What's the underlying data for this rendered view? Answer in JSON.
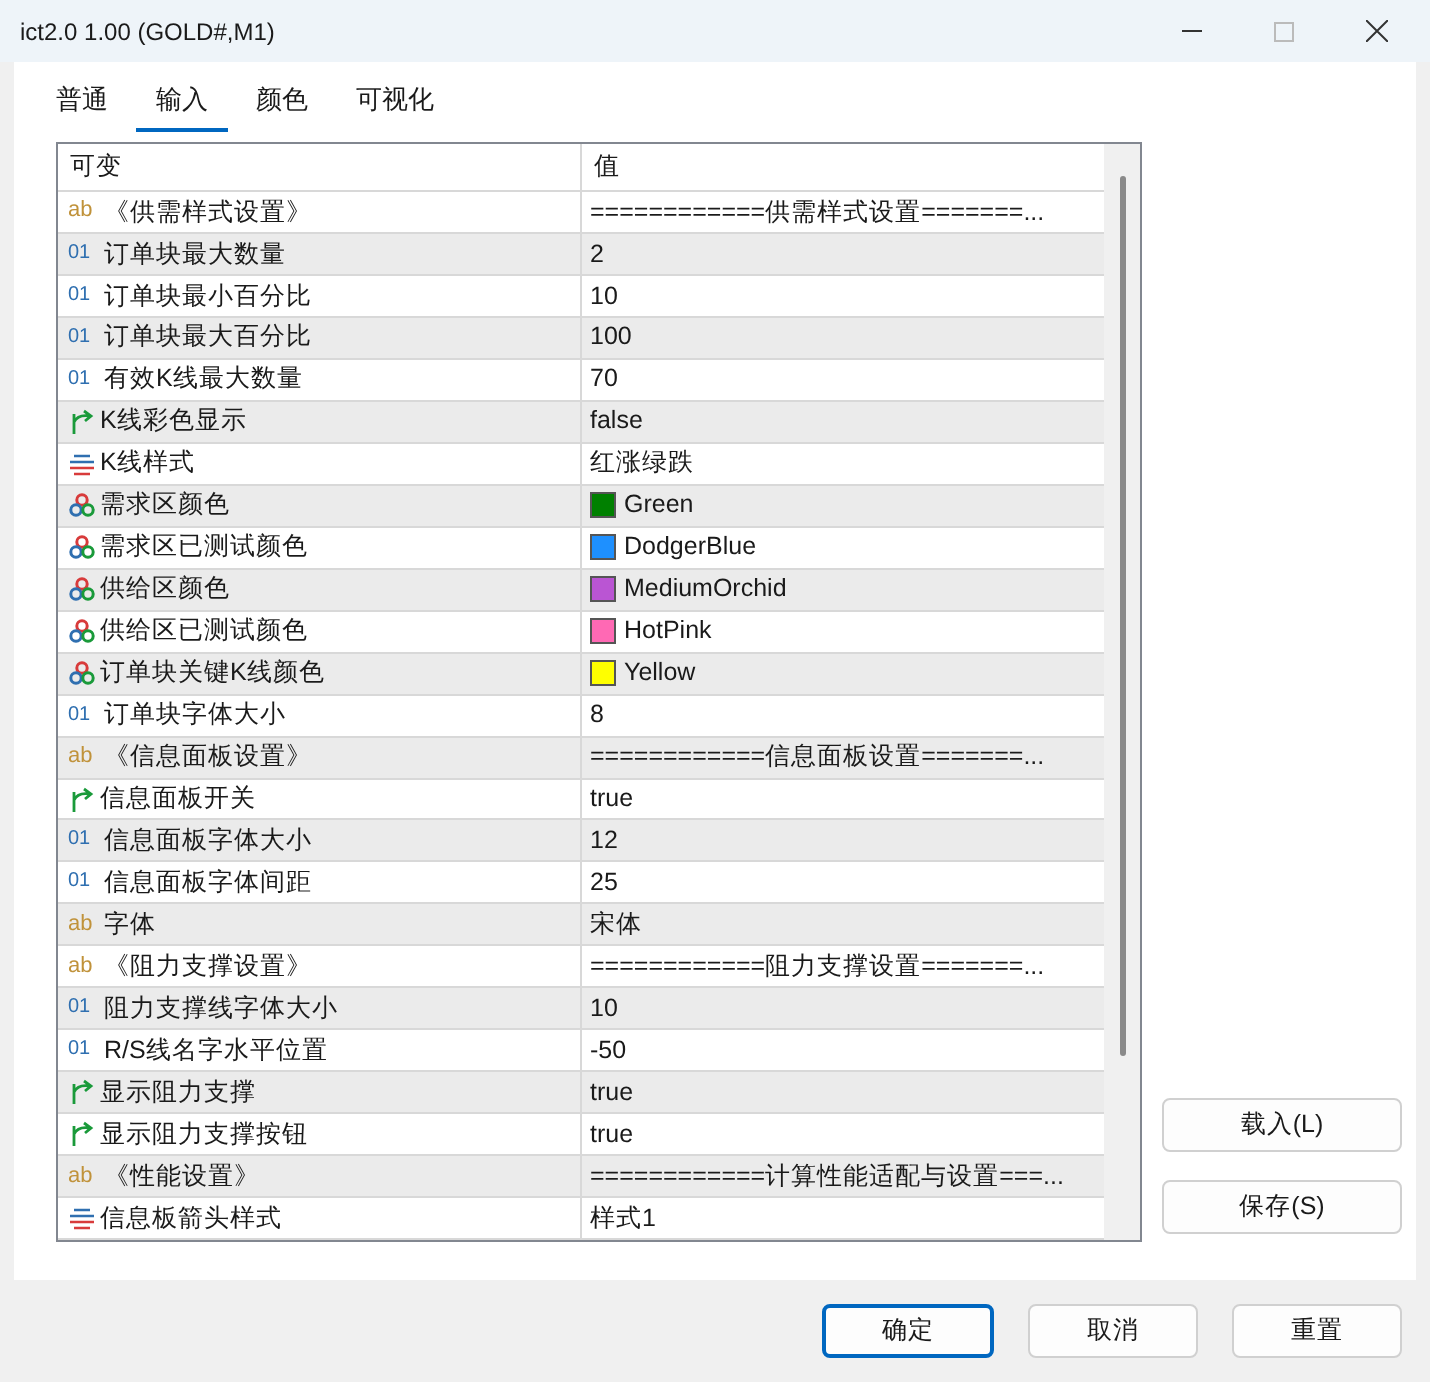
{
  "window": {
    "title": "ict2.0 1.00 (GOLD#,M1)"
  },
  "tabs": [
    {
      "label": "普通",
      "selected": false
    },
    {
      "label": "输入",
      "selected": true
    },
    {
      "label": "颜色",
      "selected": false
    },
    {
      "label": "可视化",
      "selected": false
    }
  ],
  "table": {
    "columns": [
      "可变",
      "值"
    ],
    "rows": [
      {
        "kind": "text",
        "icon": "ab",
        "name": "《供需样式设置》",
        "value": "============供需样式设置=======..."
      },
      {
        "kind": "int",
        "icon": "01",
        "name": "订单块最大数量",
        "value": "2"
      },
      {
        "kind": "int",
        "icon": "01",
        "name": "订单块最小百分比",
        "value": "10"
      },
      {
        "kind": "int",
        "icon": "01",
        "name": "订单块最大百分比",
        "value": "100"
      },
      {
        "kind": "int",
        "icon": "01",
        "name": "有效K线最大数量",
        "value": "70"
      },
      {
        "kind": "bool",
        "name": "K线彩色显示",
        "value": "false"
      },
      {
        "kind": "enum",
        "name": "K线样式",
        "value": "红涨绿跌"
      },
      {
        "kind": "color",
        "name": "需求区颜色",
        "value": "Green",
        "color": "#008000"
      },
      {
        "kind": "color",
        "name": "需求区已测试颜色",
        "value": "DodgerBlue",
        "color": "#1e90ff"
      },
      {
        "kind": "color",
        "name": "供给区颜色",
        "value": "MediumOrchid",
        "color": "#ba55d3"
      },
      {
        "kind": "color",
        "name": "供给区已测试颜色",
        "value": "HotPink",
        "color": "#ff69b4"
      },
      {
        "kind": "color",
        "name": "订单块关键K线颜色",
        "value": "Yellow",
        "color": "#ffff00"
      },
      {
        "kind": "int",
        "icon": "01",
        "name": "订单块字体大小",
        "value": "8"
      },
      {
        "kind": "text",
        "icon": "ab",
        "name": "《信息面板设置》",
        "value": "============信息面板设置=======..."
      },
      {
        "kind": "bool",
        "name": "信息面板开关",
        "value": "true"
      },
      {
        "kind": "int",
        "icon": "01",
        "name": "信息面板字体大小",
        "value": "12"
      },
      {
        "kind": "int",
        "icon": "01",
        "name": "信息面板字体间距",
        "value": "25"
      },
      {
        "kind": "text",
        "icon": "ab",
        "name": "字体",
        "value": "宋体"
      },
      {
        "kind": "text",
        "icon": "ab",
        "name": "《阻力支撑设置》",
        "value": "============阻力支撑设置=======..."
      },
      {
        "kind": "int",
        "icon": "01",
        "name": "阻力支撑线字体大小",
        "value": "10"
      },
      {
        "kind": "int",
        "icon": "01",
        "name": "R/S线名字水平位置",
        "value": "-50"
      },
      {
        "kind": "bool",
        "name": "显示阻力支撑",
        "value": "true"
      },
      {
        "kind": "bool",
        "name": "显示阻力支撑按钮",
        "value": "true"
      },
      {
        "kind": "text",
        "icon": "ab",
        "name": "《性能设置》",
        "value": "============计算性能适配与设置===..."
      },
      {
        "kind": "enum",
        "name": "信息板箭头样式",
        "value": "样式1"
      }
    ]
  },
  "side_buttons": [
    "载入(L)",
    "保存(S)"
  ],
  "buttons": [
    {
      "label": "确定",
      "default": true
    },
    {
      "label": "取消",
      "default": false
    },
    {
      "label": "重置",
      "default": false
    }
  ]
}
